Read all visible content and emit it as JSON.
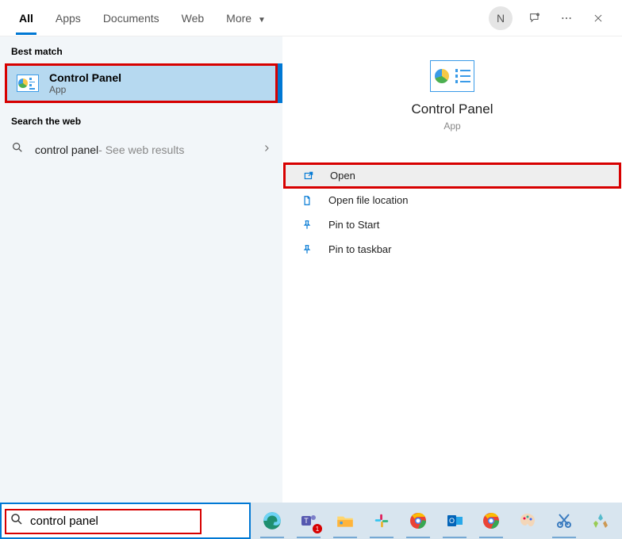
{
  "tabs": {
    "all": "All",
    "apps": "Apps",
    "documents": "Documents",
    "web": "Web",
    "more": "More"
  },
  "avatar_initial": "N",
  "left": {
    "best_match_label": "Best match",
    "result_title": "Control Panel",
    "result_sub": "App",
    "search_web_label": "Search the web",
    "web_query": "control panel",
    "web_suffix": " - See web results"
  },
  "preview": {
    "title": "Control Panel",
    "sub": "App"
  },
  "actions": {
    "open": "Open",
    "open_file_location": "Open file location",
    "pin_start": "Pin to Start",
    "pin_taskbar": "Pin to taskbar"
  },
  "search": {
    "value": "control panel"
  },
  "tray_badge": "1"
}
